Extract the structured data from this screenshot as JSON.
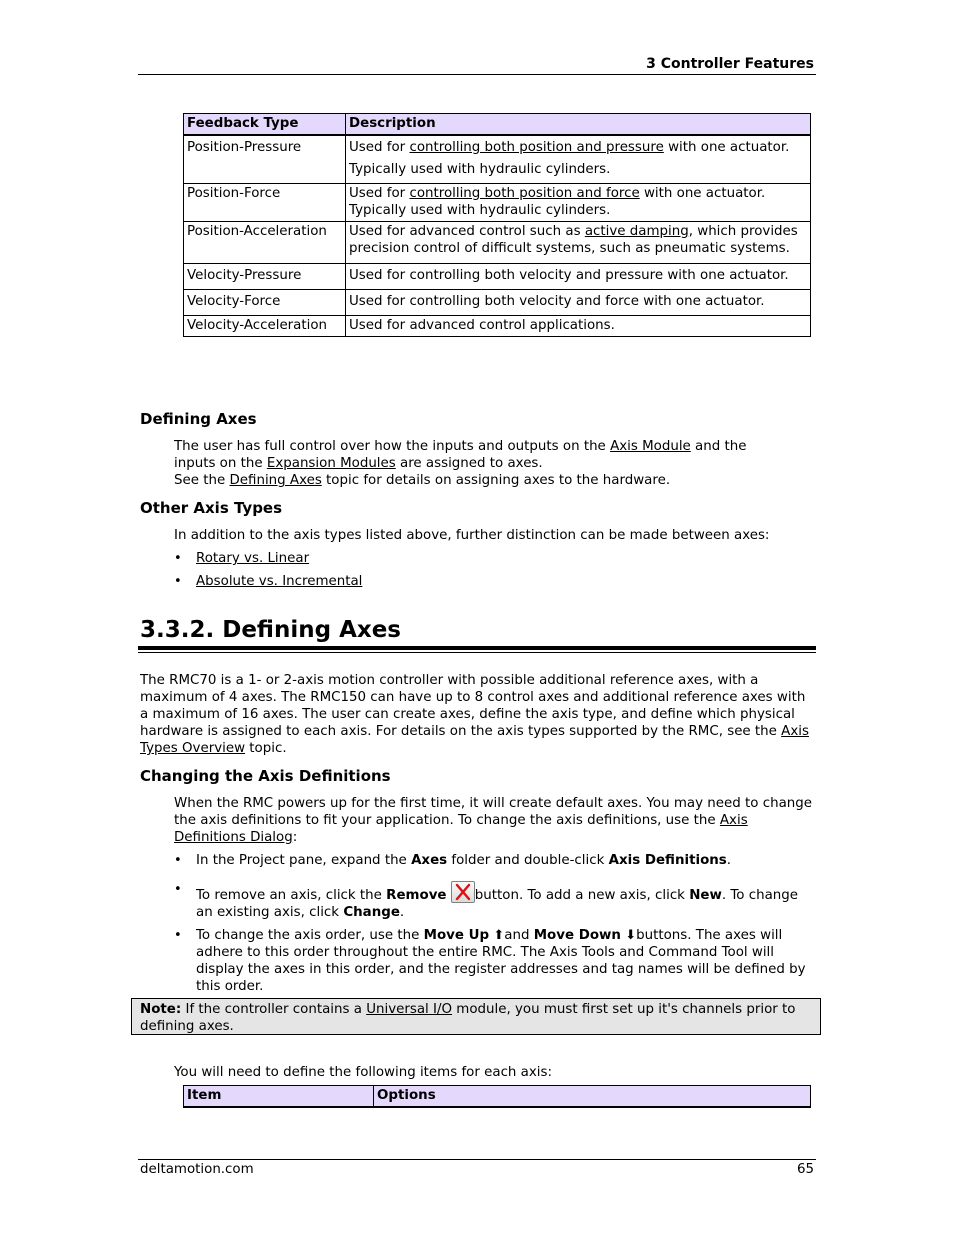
{
  "header": {
    "chapter": "3  Controller Features"
  },
  "feedback_table": {
    "columns": [
      "Feedback Type",
      "Description"
    ],
    "rows": [
      {
        "type": "Position-Pressure",
        "pre": "Used for ",
        "link": "controlling both position and pressure",
        "post": " with one actuator. Typically used with hydraulic cylinders."
      },
      {
        "type": "Position-Force",
        "pre": "Used for ",
        "link": "controlling both position and force",
        "post": " with one actuator. Typically used with hydraulic cylinders."
      },
      {
        "type": "Position-Acceleration",
        "pre": "Used for advanced control such as ",
        "link": "active damping",
        "post": ", which provides precision control of difficult systems, such as pneumatic systems."
      },
      {
        "type": "Velocity-Pressure",
        "text": "Used for controlling both velocity and pressure with one actuator."
      },
      {
        "type": "Velocity-Force",
        "text": "Used for controlling both velocity and force with one actuator."
      },
      {
        "type": "Velocity-Acceleration",
        "text": "Used for advanced control applications."
      }
    ]
  },
  "defining_axes_sub": {
    "heading": "Defining Axes",
    "l1_pre": "The user has full control over how the inputs and outputs on the ",
    "l1_link": "Axis Module",
    "l1_post": " and the",
    "l2_pre": "inputs on the ",
    "l2_link": "Expansion Modules",
    "l2_post": " are assigned to axes.",
    "l3_pre": "See the ",
    "l3_link": "Defining Axes",
    "l3_post": " topic for details on assigning axes to the hardware."
  },
  "other_axis_types": {
    "heading": "Other Axis Types",
    "intro": "In addition to the axis types listed above, further distinction can be made between axes:",
    "items": [
      "Rotary vs. Linear",
      "Absolute vs. Incremental"
    ]
  },
  "section": {
    "title": "3.3.2. Defining Axes",
    "intro_pre": "The RMC70 is a 1- or 2-axis motion controller with possible additional reference axes, with a maximum of 4 axes. The RMC150 can have up to 8 control axes and additional reference axes with a maximum of 16 axes. The user can create axes, define the axis type, and define which physical hardware is assigned to each axis. For details on the axis types supported by the RMC, see the ",
    "intro_link": "Axis Types Overview",
    "intro_post": " topic."
  },
  "changing": {
    "heading": "Changing the Axis Definitions",
    "para_pre": "When the RMC powers up for the first time, it will create default axes. You may need to change the axis definitions to fit your application. To change the axis definitions, use the ",
    "para_link": "Axis Definitions Dialog",
    "para_post": ":",
    "b1_pre": "In the Project pane, expand the ",
    "b1_bold1": "Axes",
    "b1_mid": " folder and double-click ",
    "b1_bold2": "Axis Definitions",
    "b1_post": ".",
    "b2_pre": "To remove an axis, click the ",
    "b2_bold1": "Remove",
    "b2_icon": "remove-x-icon",
    "b2_mid1": "button. To add a new axis, click ",
    "b2_bold2": "New",
    "b2_mid2": ". To change an existing axis, click ",
    "b2_bold3": "Change",
    "b2_post": ".",
    "b3_pre": "To change the axis order, use the ",
    "b3_bold1": "Move Up",
    "b3_icon1": "⬆",
    "b3_mid": "and ",
    "b3_bold2": "Move Down",
    "b3_icon2": "⬇",
    "b3_post": "buttons. The axes will adhere to this order throughout the entire RMC. The Axis Tools and Command Tool will display the axes in this order, and the register addresses and tag names will be defined by this order."
  },
  "note": {
    "label": "Note:",
    "pre": " If the controller contains a ",
    "link": "Universal I/O",
    "post": " module, you must first set up it's channels prior to defining axes."
  },
  "items_intro": "You will need to define the following items for each axis:",
  "items_table": {
    "columns": [
      "Item",
      "Options"
    ]
  },
  "footer": {
    "site": "deltamotion.com",
    "page": "65"
  }
}
